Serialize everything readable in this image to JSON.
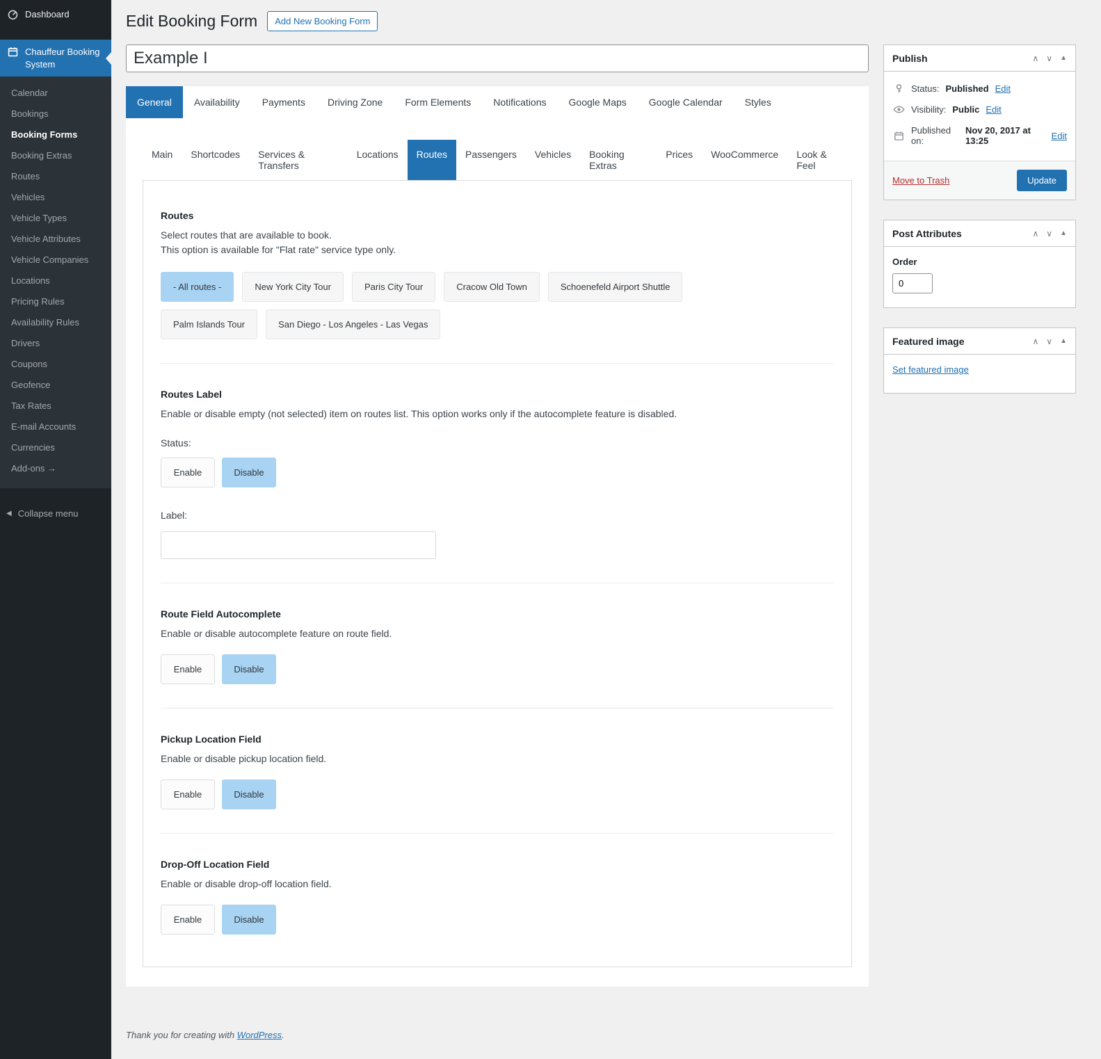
{
  "colors": {
    "accent": "#2271b1",
    "selected_toggle": "#a8d3f2",
    "sidebar_bg": "#1d2327",
    "trash_link": "#b32d2e"
  },
  "sidebar": {
    "dashboard_label": "Dashboard",
    "plugin_label": "Chauffeur Booking System",
    "items": [
      "Calendar",
      "Bookings",
      "Booking Forms",
      "Booking Extras",
      "Routes",
      "Vehicles",
      "Vehicle Types",
      "Vehicle Attributes",
      "Vehicle Companies",
      "Locations",
      "Pricing Rules",
      "Availability Rules",
      "Drivers",
      "Coupons",
      "Geofence",
      "Tax Rates",
      "E-mail Accounts",
      "Currencies",
      "Add-ons →"
    ],
    "collapse_label": "Collapse menu"
  },
  "header": {
    "title": "Edit Booking Form",
    "add_new_button": "Add New Booking Form"
  },
  "title_field": {
    "value": "Example I"
  },
  "tabs": {
    "primary": [
      "General",
      "Availability",
      "Payments",
      "Driving Zone",
      "Form Elements",
      "Notifications",
      "Google Maps",
      "Google Calendar",
      "Styles"
    ],
    "primary_active": "General",
    "secondary": [
      "Main",
      "Shortcodes",
      "Services & Transfers",
      "Locations",
      "Routes",
      "Passengers",
      "Vehicles",
      "Booking Extras",
      "Prices",
      "WooCommerce",
      "Look & Feel"
    ],
    "secondary_active": "Routes"
  },
  "toggle": {
    "enable": "Enable",
    "disable": "Disable"
  },
  "sections": {
    "routes": {
      "heading": "Routes",
      "desc1": "Select routes that are available to book.",
      "desc2": "This option is available for \"Flat rate\" service type only.",
      "options": [
        "- All routes -",
        "New York City Tour",
        "Paris City Tour",
        "Cracow Old Town",
        "Schoenefeld Airport Shuttle",
        "Palm Islands Tour",
        "San Diego - Los Angeles - Las Vegas"
      ],
      "selected_option": "- All routes -"
    },
    "routes_label": {
      "heading": "Routes Label",
      "desc": "Enable or disable empty (not selected) item on routes list. This option works only if the autocomplete feature is disabled.",
      "status_label": "Status:",
      "active_toggle": "Disable",
      "label_label": "Label:",
      "label_value": ""
    },
    "autocomplete": {
      "heading": "Route Field Autocomplete",
      "desc": "Enable or disable autocomplete feature on route field.",
      "active_toggle": "Disable"
    },
    "pickup": {
      "heading": "Pickup Location Field",
      "desc": "Enable or disable pickup location field.",
      "active_toggle": "Disable"
    },
    "dropoff": {
      "heading": "Drop-Off Location Field",
      "desc": "Enable or disable drop-off location field.",
      "active_toggle": "Disable"
    }
  },
  "publish": {
    "title": "Publish",
    "status_label": "Status:",
    "status_value": "Published",
    "visibility_label": "Visibility:",
    "visibility_value": "Public",
    "published_label": "Published on:",
    "published_value": "Nov 20, 2017 at 13:25",
    "edit_link": "Edit",
    "move_to_trash": "Move to Trash",
    "update_button": "Update"
  },
  "post_attributes": {
    "title": "Post Attributes",
    "order_label": "Order",
    "order_value": "0"
  },
  "featured_image": {
    "title": "Featured image",
    "set_link": "Set featured image"
  },
  "footer": {
    "text": "Thank you for creating with",
    "link": "WordPress",
    "suffix": "."
  }
}
